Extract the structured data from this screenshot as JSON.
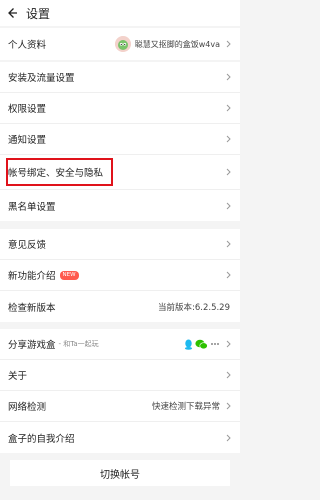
{
  "header": {
    "title": "设置"
  },
  "profile": {
    "label": "个人资料",
    "username": "聪慧又抠脚的盒饭w4va"
  },
  "group2": [
    {
      "label": "安装及流量设置"
    },
    {
      "label": "权限设置"
    },
    {
      "label": "通知设置"
    },
    {
      "label": "帐号绑定、安全与隐私"
    },
    {
      "label": "黑名单设置"
    }
  ],
  "group3": {
    "feedback": "意见反馈",
    "new_features": "新功能介绍",
    "new_badge": "NEW",
    "check_version": "检查新版本",
    "current_version": "当前版本:6.2.5.29"
  },
  "group4": {
    "share": "分享游戏盒",
    "share_sub": "- 和Ta一起玩",
    "about": "关于",
    "network": "网络检测",
    "network_status": "快速检测下载异常",
    "intro": "盒子的自我介绍"
  },
  "footer": {
    "switch_account": "切换帐号"
  },
  "colors": {
    "highlight": "#e0121b",
    "badge": "#ff5a4e",
    "qq": "#1ebaf0",
    "wechat": "#2dc100"
  }
}
